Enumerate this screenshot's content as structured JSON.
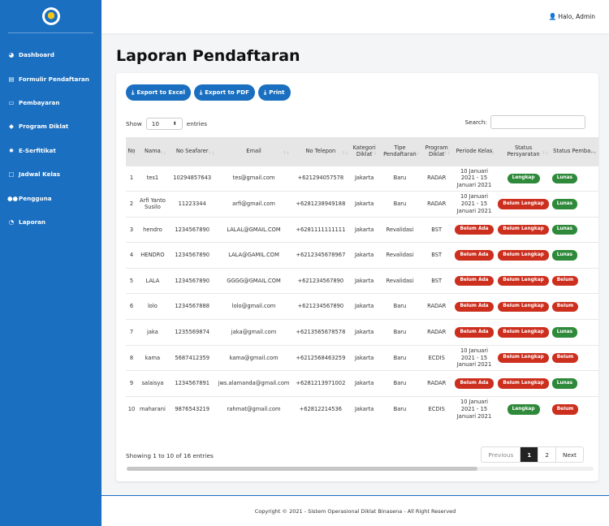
{
  "header": {
    "user_label": "Halo, Admin"
  },
  "sidebar": {
    "items": [
      {
        "label": "Dashboard",
        "icon": "dashboard-icon",
        "glyph": "◕"
      },
      {
        "label": "Formulir Pendaftaran",
        "icon": "form-icon",
        "glyph": "▤"
      },
      {
        "label": "Pembayaran",
        "icon": "credit-card-icon",
        "glyph": "▭"
      },
      {
        "label": "Program Diklat",
        "icon": "graduation-cap-icon",
        "glyph": "◆"
      },
      {
        "label": "E-Serfitikat",
        "icon": "certificate-icon",
        "glyph": "✹"
      },
      {
        "label": "Jadwal Kelas",
        "icon": "calendar-icon",
        "glyph": "▢"
      },
      {
        "label": "Pengguna",
        "icon": "users-icon",
        "glyph": "●●"
      },
      {
        "label": "Laporan",
        "icon": "chart-pie-icon",
        "glyph": "◔"
      }
    ]
  },
  "main": {
    "title": "Laporan Pendaftaran",
    "buttons": {
      "excel": "Export to Excel",
      "pdf": "Export to PDF",
      "print": "Print"
    },
    "show_label": "Show",
    "entries_value": "10",
    "entries_label": "entries",
    "search_label": "Search:",
    "columns": [
      "No",
      "Nama",
      "No Seafarer",
      "Email",
      "No Telepon",
      "Kategori Diklat",
      "Tipe Pendaftaran",
      "Program Diklat",
      "Periode Kelas",
      "Status Persyaratan",
      "Status Pemba..."
    ],
    "rows": [
      {
        "no": "1",
        "nama": "tes1",
        "seafarer": "10294857643",
        "email": "tes@gmail.com",
        "telepon": "+621294057578",
        "kategori": "Jakarta",
        "tipe": "Baru",
        "program": "RADAR",
        "periode": "10 Januari 2021 - 15 Januari 2021",
        "persyaratan": "Lengkap",
        "persyaratan_color": "green",
        "pembayaran": "Lunas",
        "pembayaran_color": "green"
      },
      {
        "no": "2",
        "nama": "Arfi Yanto Susilo",
        "seafarer": "11223344",
        "email": "arfi@gmail.com",
        "telepon": "+6281238949188",
        "kategori": "Jakarta",
        "tipe": "Baru",
        "program": "RADAR",
        "periode": "10 Januari 2021 - 15 Januari 2021",
        "persyaratan": "Belum Lengkap",
        "persyaratan_color": "red",
        "pembayaran": "Lunas",
        "pembayaran_color": "green"
      },
      {
        "no": "3",
        "nama": "hendro",
        "seafarer": "1234567890",
        "email": "LALAL@GMAIL.COM",
        "telepon": "+6281111111111",
        "kategori": "Jakarta",
        "tipe": "Revalidasi",
        "program": "BST",
        "periode": "Belum Ada",
        "periode_badge": true,
        "persyaratan": "Belum Lengkap",
        "persyaratan_color": "red",
        "pembayaran": "Lunas",
        "pembayaran_color": "green"
      },
      {
        "no": "4",
        "nama": "HENDRO",
        "seafarer": "1234567890",
        "email": "LALA@GAMIL.COM",
        "telepon": "+6212345678967",
        "kategori": "Jakarta",
        "tipe": "Revalidasi",
        "program": "BST",
        "periode": "Belum Ada",
        "periode_badge": true,
        "persyaratan": "Belum Lengkap",
        "persyaratan_color": "red",
        "pembayaran": "Lunas",
        "pembayaran_color": "green"
      },
      {
        "no": "5",
        "nama": "LALA",
        "seafarer": "1234567890",
        "email": "GGGG@GMAIL.COM",
        "telepon": "+621234567890",
        "kategori": "Jakarta",
        "tipe": "Revalidasi",
        "program": "BST",
        "periode": "Belum Ada",
        "periode_badge": true,
        "persyaratan": "Belum Lengkap",
        "persyaratan_color": "red",
        "pembayaran": "Belum",
        "pembayaran_color": "red"
      },
      {
        "no": "6",
        "nama": "lolo",
        "seafarer": "1234567888",
        "email": "lolo@gmail.com",
        "telepon": "+621234567890",
        "kategori": "Jakarta",
        "tipe": "Baru",
        "program": "RADAR",
        "periode": "Belum Ada",
        "periode_badge": true,
        "persyaratan": "Belum Lengkap",
        "persyaratan_color": "red",
        "pembayaran": "Belum",
        "pembayaran_color": "red"
      },
      {
        "no": "7",
        "nama": "jaka",
        "seafarer": "1235569874",
        "email": "jaka@gmail.com",
        "telepon": "+6213565678578",
        "kategori": "Jakarta",
        "tipe": "Baru",
        "program": "RADAR",
        "periode": "Belum Ada",
        "periode_badge": true,
        "persyaratan": "Belum Lengkap",
        "persyaratan_color": "red",
        "pembayaran": "Lunas",
        "pembayaran_color": "green"
      },
      {
        "no": "8",
        "nama": "kama",
        "seafarer": "5687412359",
        "email": "kama@gmail.com",
        "telepon": "+6212568463259",
        "kategori": "Jakarta",
        "tipe": "Baru",
        "program": "ECDIS",
        "periode": "10 Januari 2021 - 15 Januari 2021",
        "persyaratan": "Belum Lengkap",
        "persyaratan_color": "red",
        "pembayaran": "Belum",
        "pembayaran_color": "red"
      },
      {
        "no": "9",
        "nama": "salaisya",
        "seafarer": "1234567891",
        "email": "jws.alamanda@gmail.com",
        "telepon": "+6281213971002",
        "kategori": "Jakarta",
        "tipe": "Baru",
        "program": "RADAR",
        "periode": "Belum Ada",
        "periode_badge": true,
        "persyaratan": "Belum Lengkap",
        "persyaratan_color": "red",
        "pembayaran": "Lunas",
        "pembayaran_color": "green"
      },
      {
        "no": "10",
        "nama": "maharani",
        "seafarer": "9876543219",
        "email": "rahmat@gmail.com",
        "telepon": "+62812214536",
        "kategori": "Jakarta",
        "tipe": "Baru",
        "program": "ECDIS",
        "periode": "10 Januari 2021 - 15 Januari 2021",
        "persyaratan": "Lengkap",
        "persyaratan_color": "green",
        "pembayaran": "Belum",
        "pembayaran_color": "red"
      }
    ],
    "showing_text": "Showing 1 to 10 of 16 entries",
    "pagination": {
      "previous": "Previous",
      "pages": [
        "1",
        "2"
      ],
      "active": "1",
      "next": "Next"
    }
  },
  "footer": {
    "text": "Copyright © 2021 - Sistem Operasional Diklat Binasena - All Right Reserved"
  },
  "colors": {
    "primary": "#1a6fc0",
    "success": "#2e8a3a",
    "danger": "#cc2f1e"
  }
}
